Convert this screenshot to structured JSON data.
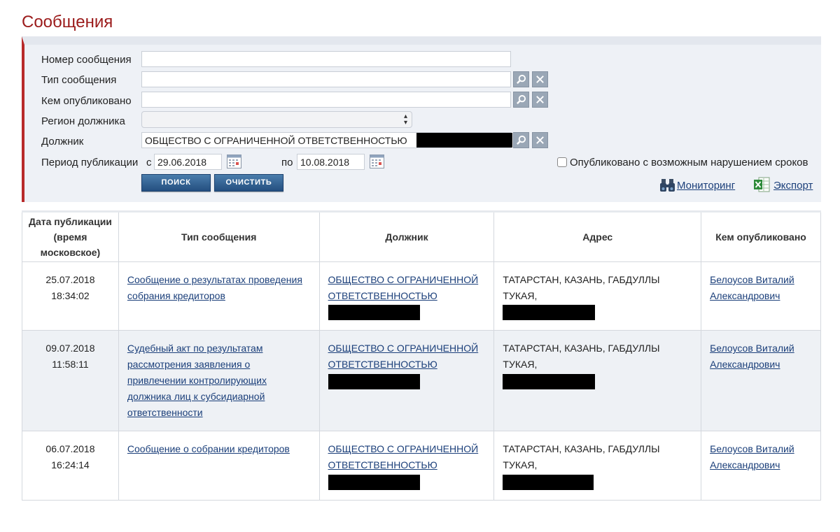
{
  "page_title": "Сообщения",
  "filters": {
    "message_number_label": "Номер сообщения",
    "message_number_value": "",
    "message_type_label": "Тип сообщения",
    "message_type_value": "",
    "published_by_label": "Кем опубликовано",
    "published_by_value": "",
    "debtor_region_label": "Регион должника",
    "debtor_region_value": "",
    "debtor_label": "Должник",
    "debtor_value": "ОБЩЕСТВО С ОГРАНИЧЕННОЙ ОТВЕТСТВЕННОСТЬЮ",
    "period_label": "Период публикации",
    "from_label": "с",
    "from_value": "29.06.2018",
    "to_label": "по",
    "to_value": "10.08.2018",
    "violation_checkbox_label": "Опубликовано с возможным нарушением сроков",
    "violation_checked": false,
    "search_button": "ПОИСК",
    "clear_button": "ОЧИСТИТЬ",
    "monitoring_link": "Мониторинг",
    "export_link": "Экспорт"
  },
  "table": {
    "headers": {
      "date": [
        "Дата публикации",
        "(время",
        "московское)"
      ],
      "type": "Тип сообщения",
      "debtor": "Должник",
      "address": "Адрес",
      "published_by": "Кем опубликовано"
    },
    "rows": [
      {
        "date": "25.07.2018",
        "time": "18:34:02",
        "type": "Сообщение о результатах проведения собрания кредиторов",
        "debtor": "ОБЩЕСТВО С ОГРАНИЧЕННОЙ ОТВЕТСТВЕННОСТЬЮ",
        "address": "ТАТАРСТАН, КАЗАНЬ, ГАБДУЛЛЫ ТУКАЯ,",
        "published_by": "Белоусов Виталий Александрович"
      },
      {
        "date": "09.07.2018",
        "time": "11:58:11",
        "type": "Судебный акт по результатам рассмотрения заявления о привлечении контролирующих должника лиц к субсидиарной ответственности",
        "debtor": "ОБЩЕСТВО С ОГРАНИЧЕННОЙ ОТВЕТСТВЕННОСТЬЮ",
        "address": "ТАТАРСТАН, КАЗАНЬ, ГАБДУЛЛЫ ТУКАЯ,",
        "published_by": "Белоусов Виталий Александрович"
      },
      {
        "date": "06.07.2018",
        "time": "16:24:14",
        "type": "Сообщение о собрании кредиторов",
        "debtor": "ОБЩЕСТВО С ОГРАНИЧЕННОЙ ОТВЕТСТВЕННОСТЬЮ",
        "address": "ТАТАРСТАН, КАЗАНЬ, ГАБДУЛЛЫ ТУКАЯ,",
        "published_by": "Белоусов Виталий Александрович"
      }
    ]
  },
  "colors": {
    "title": "#9b1b1b",
    "accent_border": "#b82a2a",
    "link": "#1b3f7a",
    "button": "#2e5d8f",
    "redaction": "#000000"
  },
  "icons": [
    "magnifier-icon",
    "clear-x-icon",
    "calendar-icon",
    "binoculars-icon",
    "excel-icon"
  ]
}
